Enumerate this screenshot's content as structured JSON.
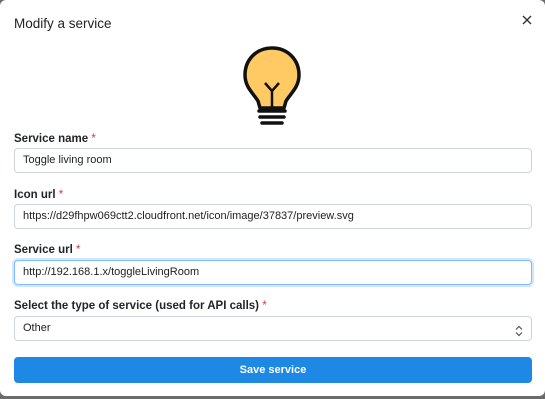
{
  "modal": {
    "title": "Modify a service",
    "close_icon": "close-icon",
    "preview_icon": "lightbulb-icon"
  },
  "fields": {
    "service_name": {
      "label": "Service name",
      "required_mark": "*",
      "value": "Toggle living room"
    },
    "icon_url": {
      "label": "Icon url",
      "required_mark": "*",
      "value": "https://d29fhpw069ctt2.cloudfront.net/icon/image/37837/preview.svg"
    },
    "service_url": {
      "label": "Service url",
      "required_mark": "*",
      "value": "http://192.168.1.x/toggleLivingRoom"
    },
    "service_type": {
      "label": "Select the type of service (used for API calls)",
      "required_mark": "*",
      "value": "Other",
      "arrow_icon": "select-updown-icon"
    }
  },
  "actions": {
    "save_label": "Save service"
  },
  "colors": {
    "accent": "#1e88e5",
    "required": "#dc3545",
    "bulb_fill": "#ffc964"
  }
}
